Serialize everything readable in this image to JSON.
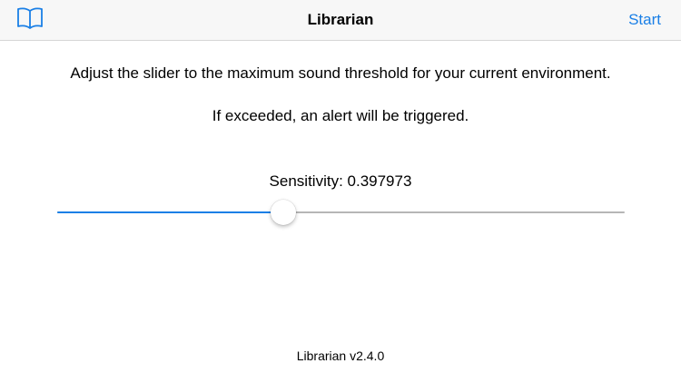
{
  "navbar": {
    "title": "Librarian",
    "right_action": "Start",
    "left_icon": "book-icon",
    "accent_color": "#1a7fe6"
  },
  "main": {
    "instruction_line1": "Adjust the slider to the maximum sound threshold for your current environment.",
    "instruction_line2": "If exceeded, an alert will be triggered.",
    "sensitivity_label": "Sensitivity: 0.397973",
    "slider": {
      "value": 0.397973,
      "min": 0,
      "max": 1
    }
  },
  "footer": {
    "version": "Librarian v2.4.0"
  }
}
